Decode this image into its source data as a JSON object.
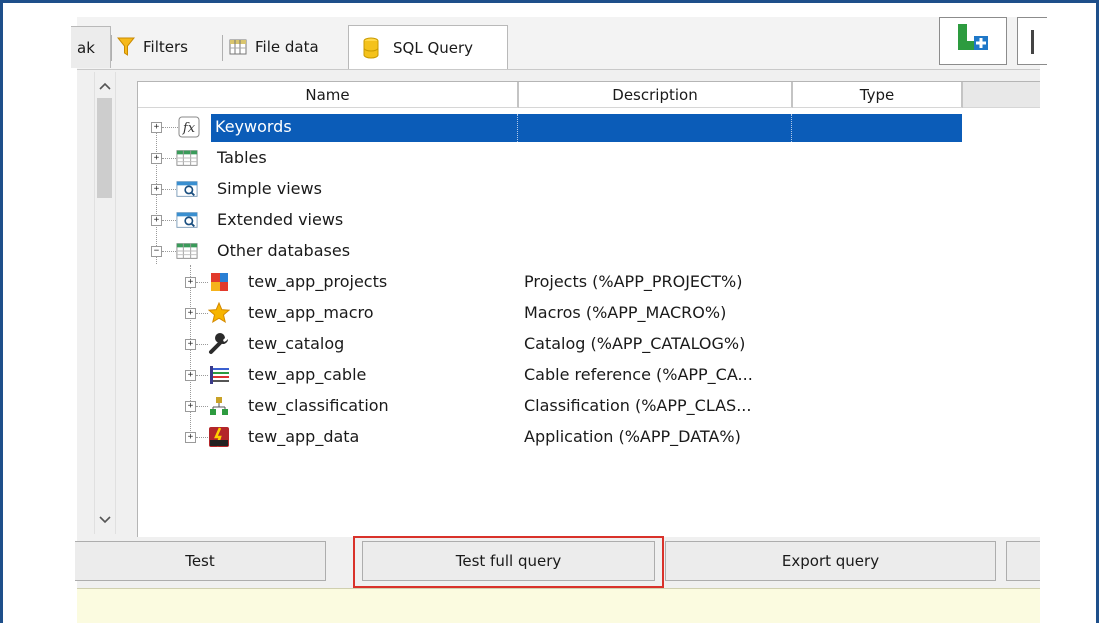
{
  "tabs": [
    {
      "label": "ak",
      "icon": "clipped-tab-edge"
    },
    {
      "label": "Filters",
      "icon": "funnel-icon"
    },
    {
      "label": "File data",
      "icon": "file-data-icon"
    },
    {
      "label": "SQL Query",
      "icon": "database-icon",
      "active": true
    }
  ],
  "tree": {
    "columns": [
      "Name",
      "Description",
      "Type"
    ],
    "groups": [
      {
        "label": "Keywords",
        "icon": "function-icon",
        "expanded": false,
        "selected": true
      },
      {
        "label": "Tables",
        "icon": "table-icon",
        "expanded": false
      },
      {
        "label": "Simple views",
        "icon": "view-icon",
        "expanded": false
      },
      {
        "label": "Extended views",
        "icon": "view-icon",
        "expanded": false
      },
      {
        "label": "Other databases",
        "icon": "table-icon",
        "expanded": true
      }
    ],
    "databases": [
      {
        "name": "tew_app_projects",
        "description": "Projects (%APP_PROJECT%)",
        "icon": "projects-icon"
      },
      {
        "name": "tew_app_macro",
        "description": "Macros (%APP_MACRO%)",
        "icon": "star-icon"
      },
      {
        "name": "tew_catalog",
        "description": "Catalog (%APP_CATALOG%)",
        "icon": "wrench-icon"
      },
      {
        "name": "tew_app_cable",
        "description": "Cable reference (%APP_CA...",
        "icon": "cable-icon"
      },
      {
        "name": "tew_classification",
        "description": "Classification (%APP_CLAS...",
        "icon": "hierarchy-icon"
      },
      {
        "name": "tew_app_data",
        "description": "Application (%APP_DATA%)",
        "icon": "app-data-icon"
      }
    ]
  },
  "buttons": {
    "test": "Test",
    "test_full_query": "Test full query",
    "export_query": "Export query"
  },
  "colors": {
    "selection": "#0b5cb8",
    "highlight_border": "#d9322a",
    "status_bar": "#fbfbe0",
    "frame": "#1e4f8a"
  }
}
